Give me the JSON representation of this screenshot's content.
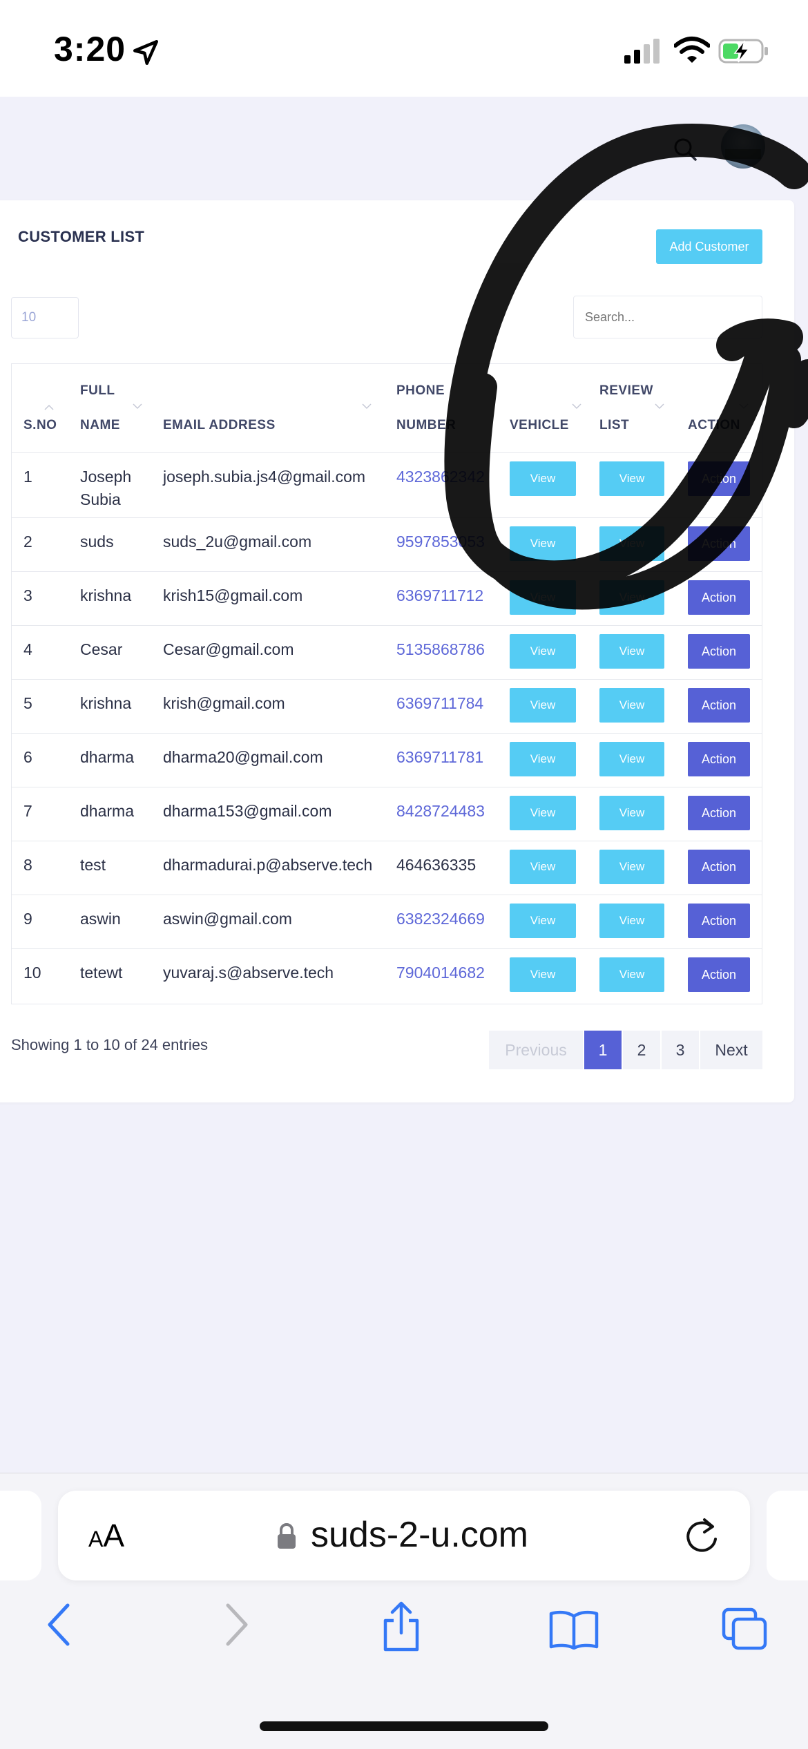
{
  "status_bar": {
    "time": "3:20"
  },
  "header": {
    "search_icon": "search-icon",
    "avatar_icon": "avatar"
  },
  "card": {
    "title": "CUSTOMER LIST",
    "add_button": "Add Customer",
    "page_length": "10",
    "search_placeholder": "Search..."
  },
  "table": {
    "headers": {
      "sno": "S.NO",
      "full_l1": "FULL",
      "full_l2": "NAME",
      "email": "EMAIL ADDRESS",
      "phone_l1": "PHONE",
      "phone_l2": "NUMBER",
      "vehicle": "VEHICLE",
      "review_l1": "REVIEW",
      "review_l2": "LIST",
      "action": "ACTION"
    },
    "rows": [
      {
        "sno": "1",
        "name_l1": "Joseph",
        "name_l2": "Subia",
        "email": "joseph.subia.js4@gmail.com",
        "phone": "4323862342",
        "vehicle": "View",
        "review": "View",
        "action": "Action"
      },
      {
        "sno": "2",
        "name_l1": "suds",
        "name_l2": "",
        "email": "suds_2u@gmail.com",
        "phone": "9597853053",
        "vehicle": "View",
        "review": "View",
        "action": "Action"
      },
      {
        "sno": "3",
        "name_l1": "krishna",
        "name_l2": "",
        "email": "krish15@gmail.com",
        "phone": "6369711712",
        "vehicle": "View",
        "review": "View",
        "action": "Action"
      },
      {
        "sno": "4",
        "name_l1": "Cesar",
        "name_l2": "",
        "email": "Cesar@gmail.com",
        "phone": "5135868786",
        "vehicle": "View",
        "review": "View",
        "action": "Action"
      },
      {
        "sno": "5",
        "name_l1": "krishna",
        "name_l2": "",
        "email": "krish@gmail.com",
        "phone": "6369711784",
        "vehicle": "View",
        "review": "View",
        "action": "Action"
      },
      {
        "sno": "6",
        "name_l1": "dharma",
        "name_l2": "",
        "email": "dharma20@gmail.com",
        "phone": "6369711781",
        "vehicle": "View",
        "review": "View",
        "action": "Action"
      },
      {
        "sno": "7",
        "name_l1": "dharma",
        "name_l2": "",
        "email": "dharma153@gmail.com",
        "phone": "8428724483",
        "vehicle": "View",
        "review": "View",
        "action": "Action"
      },
      {
        "sno": "8",
        "name_l1": "test",
        "name_l2": "",
        "email": "dharmadurai.p@abserve.tech",
        "phone": "464636335",
        "vehicle": "View",
        "review": "View",
        "action": "Action"
      },
      {
        "sno": "9",
        "name_l1": "aswin",
        "name_l2": "",
        "email": "aswin@gmail.com",
        "phone": "6382324669",
        "vehicle": "View",
        "review": "View",
        "action": "Action"
      },
      {
        "sno": "10",
        "name_l1": "tetewt",
        "name_l2": "",
        "email": "yuvaraj.s@abserve.tech",
        "phone": "7904014682",
        "vehicle": "View",
        "review": "View",
        "action": "Action"
      }
    ]
  },
  "footer": {
    "showing": "Showing 1 to 10 of 24 entries",
    "pagination": {
      "previous": "Previous",
      "pages": [
        "1",
        "2",
        "3"
      ],
      "next": "Next",
      "current": "1"
    }
  },
  "browser": {
    "aa_small": "A",
    "aa_large": "A",
    "url": "suds-2-u.com"
  },
  "colors": {
    "accent": "#5661d6",
    "view_button": "#55ccf4",
    "page_background": "#f1f1fa",
    "link": "#5d67d8"
  }
}
